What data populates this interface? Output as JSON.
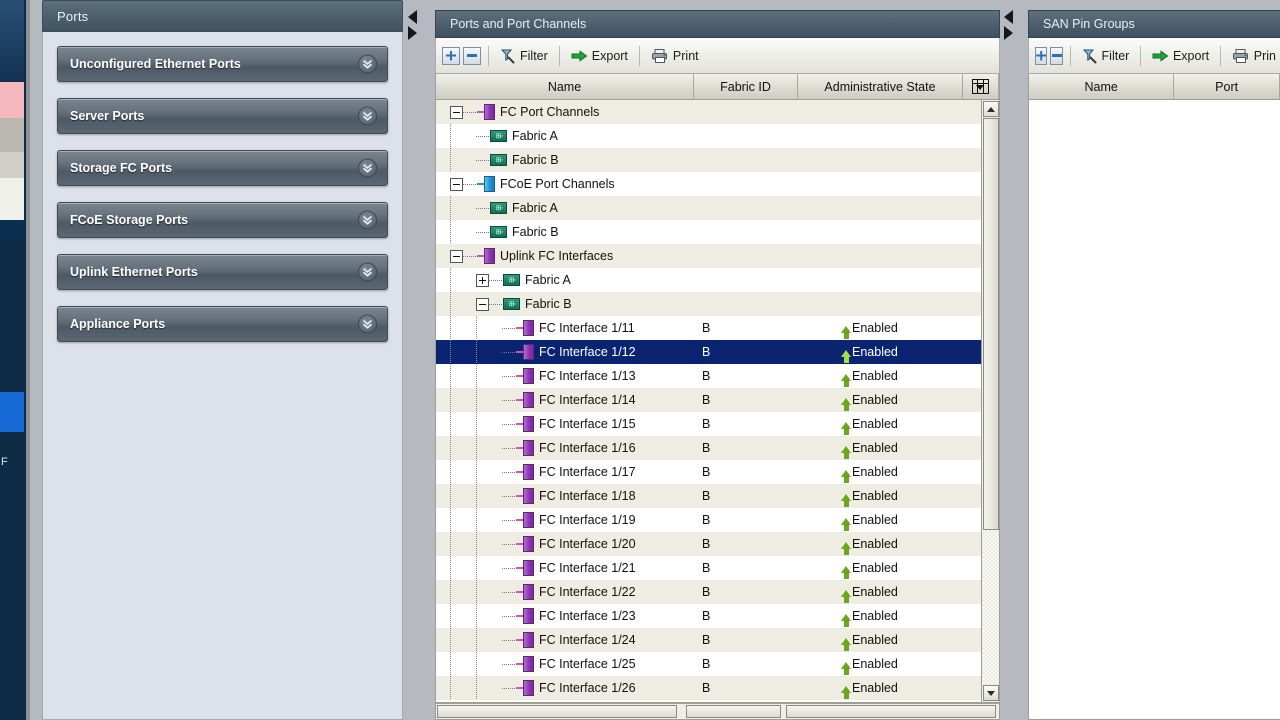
{
  "background_window": {
    "label": "F"
  },
  "ports_panel": {
    "title": "Ports",
    "items": [
      {
        "label": "Unconfigured Ethernet Ports",
        "icon": "chevron-double-down-icon"
      },
      {
        "label": "Server Ports",
        "icon": "chevron-double-down-icon"
      },
      {
        "label": "Storage FC Ports",
        "icon": "chevron-double-down-icon"
      },
      {
        "label": "FCoE Storage Ports",
        "icon": "chevron-double-down-icon"
      },
      {
        "label": "Uplink Ethernet Ports",
        "icon": "chevron-double-down-icon"
      },
      {
        "label": "Appliance Ports",
        "icon": "chevron-double-down-icon"
      }
    ]
  },
  "mid_panel": {
    "title": "Ports and Port Channels",
    "toolbar": {
      "add_label": "",
      "remove_label": "",
      "filter_label": "Filter",
      "export_label": "Export",
      "print_label": "Print"
    },
    "columns": [
      "Name",
      "Fabric ID",
      "Administrative State"
    ],
    "column_chooser_icon": "column-chooser-icon",
    "rows": [
      {
        "indent": 0,
        "twisty": "minus",
        "icon": "fc-port-channel-icon",
        "name": "FC Port Channels",
        "fabric": "",
        "admin": "",
        "selected": false
      },
      {
        "indent": 1,
        "twisty": "none",
        "icon": "fabric-icon",
        "name": "Fabric A",
        "fabric": "",
        "admin": "",
        "selected": false
      },
      {
        "indent": 1,
        "twisty": "none",
        "icon": "fabric-icon",
        "name": "Fabric B",
        "fabric": "",
        "admin": "",
        "selected": false
      },
      {
        "indent": 0,
        "twisty": "minus",
        "icon": "fcoe-port-channel-icon",
        "name": "FCoE Port Channels",
        "fabric": "",
        "admin": "",
        "selected": false
      },
      {
        "indent": 1,
        "twisty": "none",
        "icon": "fabric-icon",
        "name": "Fabric A",
        "fabric": "",
        "admin": "",
        "selected": false
      },
      {
        "indent": 1,
        "twisty": "none",
        "icon": "fabric-icon",
        "name": "Fabric B",
        "fabric": "",
        "admin": "",
        "selected": false
      },
      {
        "indent": 0,
        "twisty": "minus",
        "icon": "fc-port-channel-icon",
        "name": "Uplink FC Interfaces",
        "fabric": "",
        "admin": "",
        "selected": false
      },
      {
        "indent": 1,
        "twisty": "plus",
        "icon": "fabric-icon",
        "name": "Fabric A",
        "fabric": "",
        "admin": "",
        "selected": false
      },
      {
        "indent": 1,
        "twisty": "minus",
        "icon": "fabric-icon",
        "name": "Fabric B",
        "fabric": "",
        "admin": "",
        "selected": false
      },
      {
        "indent": 2,
        "twisty": "none",
        "icon": "fc-interface-icon",
        "name": "FC Interface 1/11",
        "fabric": "B",
        "admin": "Enabled",
        "selected": false
      },
      {
        "indent": 2,
        "twisty": "none",
        "icon": "fc-interface-icon",
        "name": "FC Interface 1/12",
        "fabric": "B",
        "admin": "Enabled",
        "selected": true
      },
      {
        "indent": 2,
        "twisty": "none",
        "icon": "fc-interface-icon",
        "name": "FC Interface 1/13",
        "fabric": "B",
        "admin": "Enabled",
        "selected": false
      },
      {
        "indent": 2,
        "twisty": "none",
        "icon": "fc-interface-icon",
        "name": "FC Interface 1/14",
        "fabric": "B",
        "admin": "Enabled",
        "selected": false
      },
      {
        "indent": 2,
        "twisty": "none",
        "icon": "fc-interface-icon",
        "name": "FC Interface 1/15",
        "fabric": "B",
        "admin": "Enabled",
        "selected": false
      },
      {
        "indent": 2,
        "twisty": "none",
        "icon": "fc-interface-icon",
        "name": "FC Interface 1/16",
        "fabric": "B",
        "admin": "Enabled",
        "selected": false
      },
      {
        "indent": 2,
        "twisty": "none",
        "icon": "fc-interface-icon",
        "name": "FC Interface 1/17",
        "fabric": "B",
        "admin": "Enabled",
        "selected": false
      },
      {
        "indent": 2,
        "twisty": "none",
        "icon": "fc-interface-icon",
        "name": "FC Interface 1/18",
        "fabric": "B",
        "admin": "Enabled",
        "selected": false
      },
      {
        "indent": 2,
        "twisty": "none",
        "icon": "fc-interface-icon",
        "name": "FC Interface 1/19",
        "fabric": "B",
        "admin": "Enabled",
        "selected": false
      },
      {
        "indent": 2,
        "twisty": "none",
        "icon": "fc-interface-icon",
        "name": "FC Interface 1/20",
        "fabric": "B",
        "admin": "Enabled",
        "selected": false
      },
      {
        "indent": 2,
        "twisty": "none",
        "icon": "fc-interface-icon",
        "name": "FC Interface 1/21",
        "fabric": "B",
        "admin": "Enabled",
        "selected": false
      },
      {
        "indent": 2,
        "twisty": "none",
        "icon": "fc-interface-icon",
        "name": "FC Interface 1/22",
        "fabric": "B",
        "admin": "Enabled",
        "selected": false
      },
      {
        "indent": 2,
        "twisty": "none",
        "icon": "fc-interface-icon",
        "name": "FC Interface 1/23",
        "fabric": "B",
        "admin": "Enabled",
        "selected": false
      },
      {
        "indent": 2,
        "twisty": "none",
        "icon": "fc-interface-icon",
        "name": "FC Interface 1/24",
        "fabric": "B",
        "admin": "Enabled",
        "selected": false
      },
      {
        "indent": 2,
        "twisty": "none",
        "icon": "fc-interface-icon",
        "name": "FC Interface 1/25",
        "fabric": "B",
        "admin": "Enabled",
        "selected": false
      },
      {
        "indent": 2,
        "twisty": "none",
        "icon": "fc-interface-icon",
        "name": "FC Interface 1/26",
        "fabric": "B",
        "admin": "Enabled",
        "selected": false
      }
    ]
  },
  "right_panel": {
    "title": "SAN Pin Groups",
    "toolbar": {
      "filter_label": "Filter",
      "export_label": "Export",
      "print_label": "Prin"
    },
    "columns": [
      "Name",
      "Port"
    ],
    "rows": []
  },
  "colors": {
    "selection": "#0a2472",
    "row_alt": "#efede1",
    "titlebar": "#4d6070",
    "enabled_arrow": "#6aa61e",
    "port_channel_icon": "#8d34b5",
    "fcoe_icon": "#1e93d6",
    "fabric_icon": "#0f6f56"
  }
}
